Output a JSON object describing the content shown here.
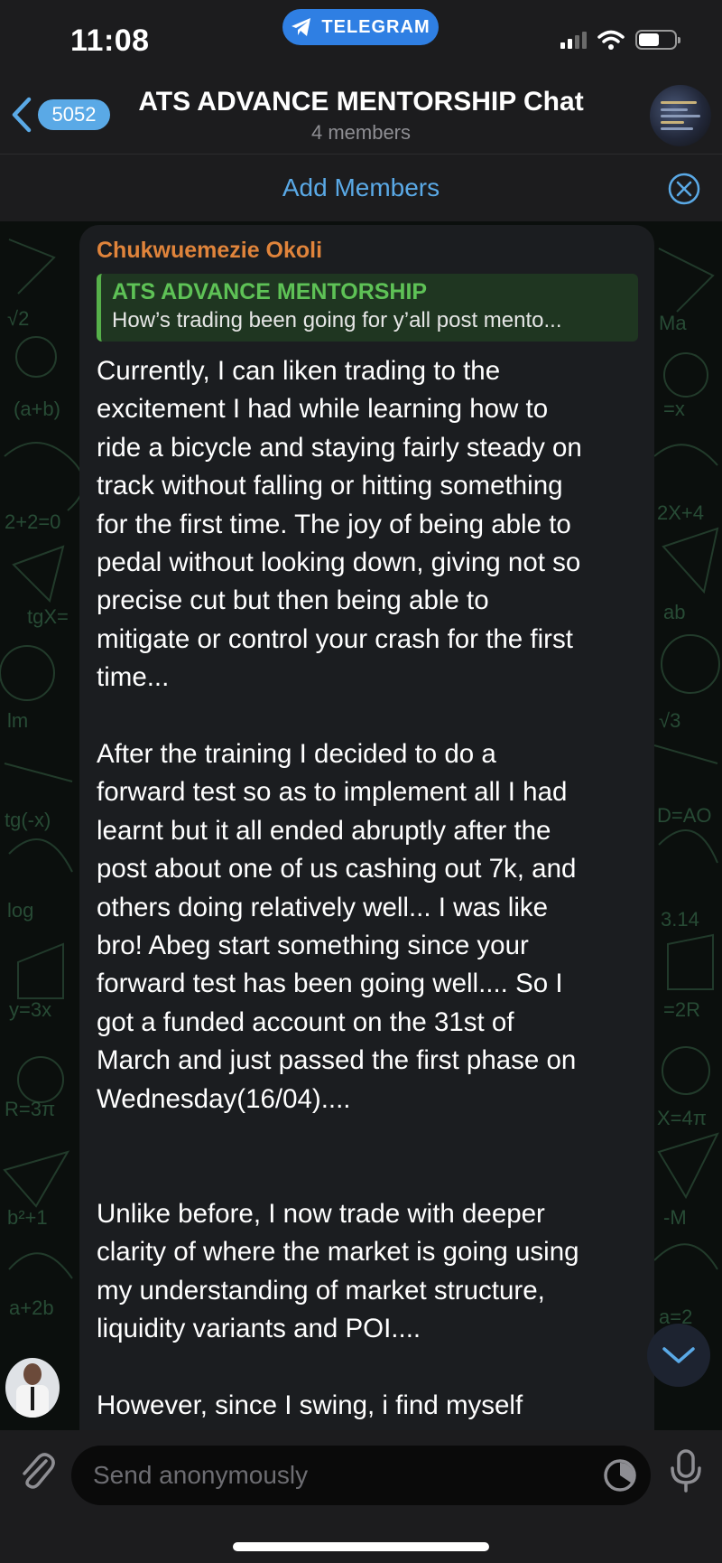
{
  "status_bar": {
    "time": "11:08",
    "pill_label": "TELEGRAM"
  },
  "header": {
    "back_count": "5052",
    "title": "ATS ADVANCE MENTORSHIP Chat",
    "subtitle": "4 members"
  },
  "add_members": {
    "label": "Add Members"
  },
  "message": {
    "sender": "Chukwuemezie Okoli",
    "reply_title": "ATS ADVANCE MENTORSHIP",
    "reply_text": "How’s trading been going for y’all post mento...",
    "paragraphs": [
      "Currently, I can liken trading to the\nexcitement I had while learning how to\nride a bicycle and staying fairly steady on\ntrack without falling or hitting something\nfor the first time. The joy of being able to\npedal without looking down, giving not so\nprecise cut but then being able to\nmitigate or control your crash for the first\ntime...",
      "After the training I decided to do a\nforward test so as to implement all I had\nlearnt but it all ended abruptly after the\npost about one of us cashing out 7k, and\nothers doing relatively well... I was like\nbro! Abeg start something since your\nforward test has been going well.... So I\ngot a funded account on the 31st of\nMarch and just passed the first phase on\nWednesday(16/04)....",
      "Unlike before, I now trade with deeper\nclarity of where the market is going using\nmy understanding of market structure,\nliquidity variants and POI....",
      "However, since I swing,  i find myself"
    ]
  },
  "input": {
    "placeholder": "Send anonymously"
  },
  "colors": {
    "accent": "#5aa9e6",
    "telegram_pill": "#2f7fe3",
    "sender_name": "#e0843b",
    "reply_green": "#5ec256"
  },
  "icons": {
    "back": "chevron-left-icon",
    "close": "close-circle-icon",
    "attach": "paperclip-icon",
    "timer": "timer-icon",
    "mic": "microphone-icon",
    "scroll": "chevron-down-icon"
  }
}
